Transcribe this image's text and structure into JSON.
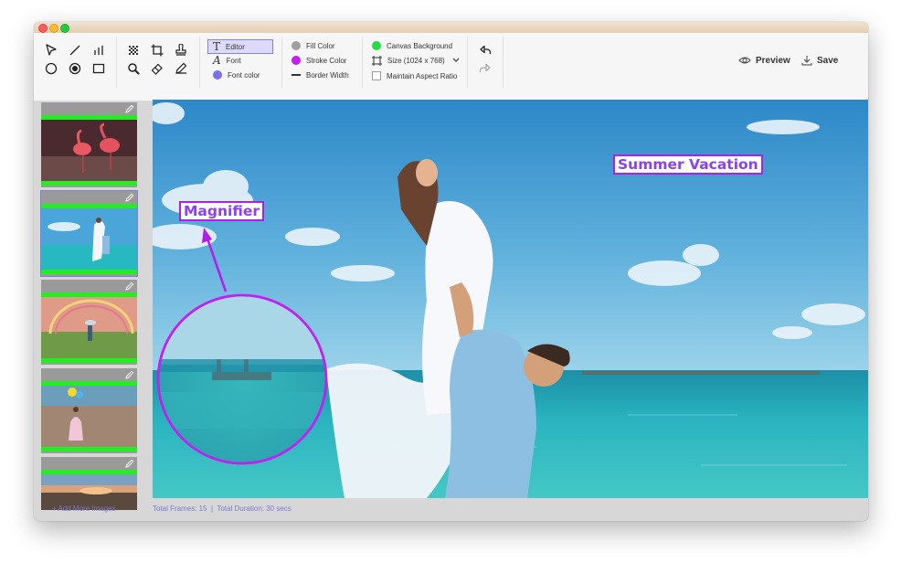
{
  "window": {
    "title": ""
  },
  "toolbar": {
    "editor_label": "Editor",
    "font_label": "Font",
    "font_color_label": "Font color",
    "fill_color_label": "Fill Color",
    "stroke_color_label": "Stroke Color",
    "border_width_label": "Border Width",
    "canvas_background_label": "Canvas Background",
    "size_label": "Size (1024 x 768)",
    "maintain_aspect_label": "Maintain Aspect Ratio",
    "preview_label": "Preview",
    "save_label": "Save",
    "colors": {
      "font_color": "#7a70e8",
      "fill_color": "#a0a0a0",
      "stroke_color": "#c41ef0",
      "canvas_background": "#22dd44"
    }
  },
  "sidebar": {
    "thumbnails": [
      {
        "subject": "flamingos",
        "selected": false
      },
      {
        "subject": "beach-couple",
        "selected": true
      },
      {
        "subject": "rainbow-field",
        "selected": false
      },
      {
        "subject": "girl-balloons",
        "selected": false
      },
      {
        "subject": "sunset",
        "selected": false
      }
    ],
    "add_more_label": "+ Add More Images"
  },
  "canvas": {
    "annotations": [
      {
        "type": "text",
        "text": "Magnifier"
      },
      {
        "type": "text",
        "text": "Summer Vacation"
      },
      {
        "type": "arrow"
      },
      {
        "type": "magnifier-circle"
      }
    ],
    "accent_color": "#b31bef"
  },
  "status": {
    "text": "Total Frames: 15  |  Total Duration: 30 secs"
  }
}
